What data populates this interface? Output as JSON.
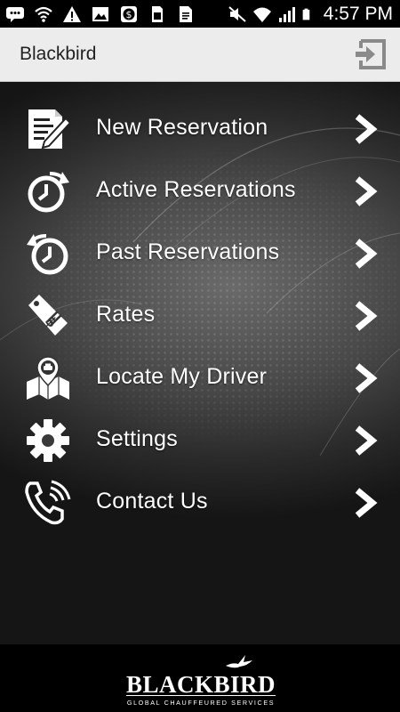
{
  "status_bar": {
    "time": "4:57 PM",
    "left_icons": [
      "message-icon",
      "wifi-icon",
      "warning-icon",
      "image-icon",
      "dollar-icon",
      "sim-icon",
      "file-icon"
    ],
    "right_icons": [
      "mute-icon",
      "wifi-icon",
      "signal-icon",
      "battery-icon"
    ]
  },
  "app_bar": {
    "title": "Blackbird",
    "action_icon": "logout-icon"
  },
  "menu": {
    "items": [
      {
        "label": "New Reservation",
        "icon": "new-reservation-icon"
      },
      {
        "label": "Active Reservations",
        "icon": "active-reservations-icon"
      },
      {
        "label": "Past Reservations",
        "icon": "past-reservations-icon"
      },
      {
        "label": "Rates",
        "icon": "rates-tag-icon"
      },
      {
        "label": "Locate My Driver",
        "icon": "locate-driver-map-icon"
      },
      {
        "label": "Settings",
        "icon": "gear-icon"
      },
      {
        "label": "Contact Us",
        "icon": "phone-icon"
      }
    ]
  },
  "footer": {
    "logo_word": "BLACKBIRD",
    "logo_tagline": "GLOBAL CHAUFFEURED SERVICES"
  },
  "colors": {
    "status_bar": "#000000",
    "app_bar": "#ececec",
    "menu_text": "#ffffff",
    "footer": "#000000"
  }
}
